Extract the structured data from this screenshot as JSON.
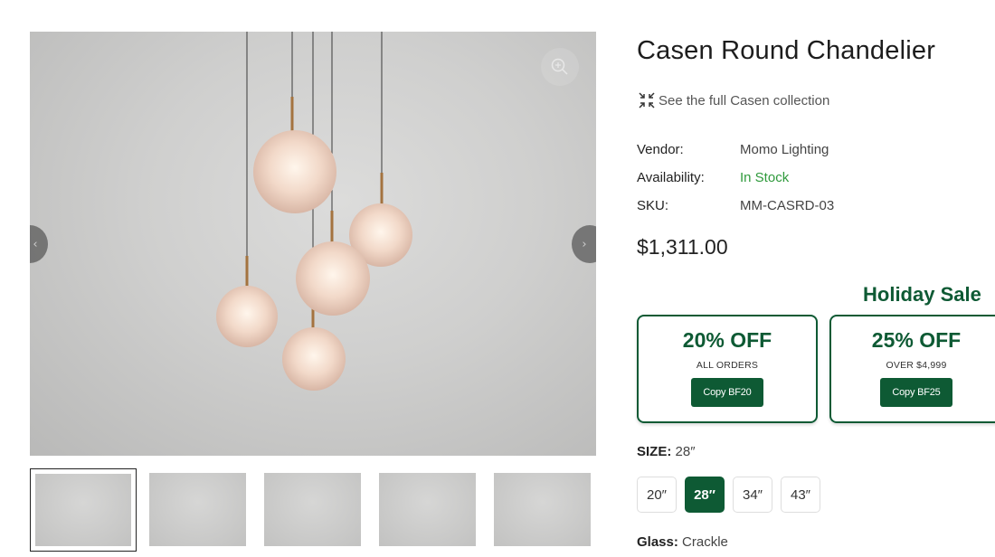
{
  "product": {
    "title": "Casen Round Chandelier",
    "collection_link": "See the full Casen collection",
    "vendor_label": "Vendor:",
    "vendor": "Momo Lighting",
    "availability_label": "Availability:",
    "availability": "In Stock",
    "sku_label": "SKU:",
    "sku": "MM-CASRD-03",
    "price": "$1,311.00"
  },
  "promo": {
    "title": "Holiday Sale",
    "coupons": [
      {
        "off": "20% OFF",
        "condition": "ALL ORDERS",
        "button": "Copy BF20"
      },
      {
        "off": "25% OFF",
        "condition": "OVER $4,999",
        "button": "Copy BF25"
      }
    ]
  },
  "options": {
    "size_label": "SIZE:",
    "size_value": "28″",
    "sizes": [
      "20″",
      "28″",
      "34″",
      "43″"
    ],
    "selected_size": "28″",
    "glass_label": "Glass:",
    "glass_value": "Crackle"
  },
  "gallery": {
    "thumbnail_count": 5,
    "active_index": 0
  },
  "colors": {
    "brand_green": "#0e5a34",
    "stock_green": "#2f9a3c"
  },
  "icons": {
    "zoom": "zoom-in-icon",
    "prev": "chevron-left-icon",
    "next": "chevron-right-icon",
    "collection": "collapse-arrows-icon"
  }
}
